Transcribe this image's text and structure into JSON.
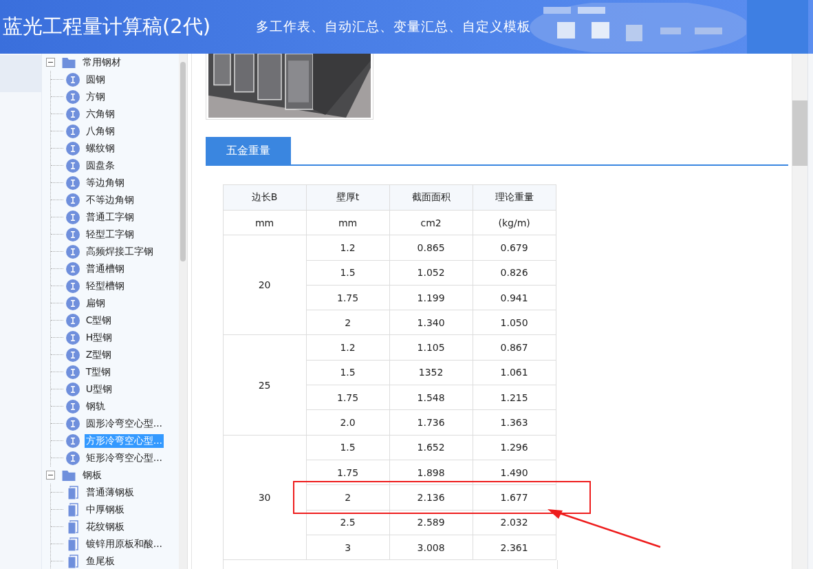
{
  "header": {
    "title": "蓝光工程量计算稿(2代)",
    "subtitle": "多工作表、自动汇总、变量汇总、自定义模板"
  },
  "tree": [
    {
      "label": "常用钢材",
      "expanded": true,
      "children": [
        {
          "label": "圆钢",
          "kind": "profile",
          "selected": false
        },
        {
          "label": "方钢",
          "kind": "profile",
          "selected": false
        },
        {
          "label": "六角钢",
          "kind": "profile",
          "selected": false
        },
        {
          "label": "八角钢",
          "kind": "profile",
          "selected": false
        },
        {
          "label": "螺纹钢",
          "kind": "profile",
          "selected": false
        },
        {
          "label": "圆盘条",
          "kind": "profile",
          "selected": false
        },
        {
          "label": "等边角钢",
          "kind": "profile",
          "selected": false
        },
        {
          "label": "不等边角钢",
          "kind": "profile",
          "selected": false
        },
        {
          "label": "普通工字钢",
          "kind": "profile",
          "selected": false
        },
        {
          "label": "轻型工字钢",
          "kind": "profile",
          "selected": false
        },
        {
          "label": "高频焊接工字钢",
          "kind": "profile",
          "selected": false
        },
        {
          "label": "普通槽钢",
          "kind": "profile",
          "selected": false
        },
        {
          "label": "轻型槽钢",
          "kind": "profile",
          "selected": false
        },
        {
          "label": "扁钢",
          "kind": "profile",
          "selected": false
        },
        {
          "label": "C型钢",
          "kind": "profile",
          "selected": false
        },
        {
          "label": "H型钢",
          "kind": "profile",
          "selected": false
        },
        {
          "label": "Z型钢",
          "kind": "profile",
          "selected": false
        },
        {
          "label": "T型钢",
          "kind": "profile",
          "selected": false
        },
        {
          "label": "U型钢",
          "kind": "profile",
          "selected": false
        },
        {
          "label": "钢轨",
          "kind": "profile",
          "selected": false
        },
        {
          "label": "圆形冷弯空心型...",
          "kind": "profile",
          "selected": false
        },
        {
          "label": "方形冷弯空心型...",
          "kind": "profile",
          "selected": true
        },
        {
          "label": "矩形冷弯空心型...",
          "kind": "profile",
          "selected": false
        }
      ]
    },
    {
      "label": "钢板",
      "expanded": true,
      "children": [
        {
          "label": "普通薄钢板",
          "kind": "plate",
          "selected": false
        },
        {
          "label": "中厚钢板",
          "kind": "plate",
          "selected": false
        },
        {
          "label": "花纹钢板",
          "kind": "plate",
          "selected": false
        },
        {
          "label": "镀锌用原板和酸...",
          "kind": "plate",
          "selected": false
        },
        {
          "label": "鱼尾板",
          "kind": "plate",
          "selected": false
        }
      ]
    }
  ],
  "section_tab": "五金重量",
  "table": {
    "columns": [
      "边长B",
      "壁厚t",
      "截面面积",
      "理论重量"
    ],
    "units": [
      "mm",
      "mm",
      "cm2",
      "(kg/m)"
    ],
    "groups": [
      {
        "side": "20",
        "rows": [
          {
            "cells": [
              "1.2",
              "0.865",
              "0.679"
            ],
            "highlighted": false
          },
          {
            "cells": [
              "1.5",
              "1.052",
              "0.826"
            ],
            "highlighted": false
          },
          {
            "cells": [
              "1.75",
              "1.199",
              "0.941"
            ],
            "highlighted": false
          },
          {
            "cells": [
              "2",
              "1.340",
              "1.050"
            ],
            "highlighted": false
          }
        ]
      },
      {
        "side": "25",
        "rows": [
          {
            "cells": [
              "1.2",
              "1.105",
              "0.867"
            ],
            "highlighted": false
          },
          {
            "cells": [
              "1.5",
              "1352",
              "1.061"
            ],
            "highlighted": false
          },
          {
            "cells": [
              "1.75",
              "1.548",
              "1.215"
            ],
            "highlighted": false
          },
          {
            "cells": [
              "2.0",
              "1.736",
              "1.363"
            ],
            "highlighted": false
          }
        ]
      },
      {
        "side": "30",
        "rows": [
          {
            "cells": [
              "1.5",
              "1.652",
              "1.296"
            ],
            "highlighted": false
          },
          {
            "cells": [
              "1.75",
              "1.898",
              "1.490"
            ],
            "highlighted": false
          },
          {
            "cells": [
              "2",
              "2.136",
              "1.677"
            ],
            "highlighted": true
          },
          {
            "cells": [
              "2.5",
              "2.589",
              "2.032"
            ],
            "highlighted": false
          },
          {
            "cells": [
              "3",
              "3.008",
              "2.361"
            ],
            "highlighted": false
          }
        ]
      }
    ]
  }
}
